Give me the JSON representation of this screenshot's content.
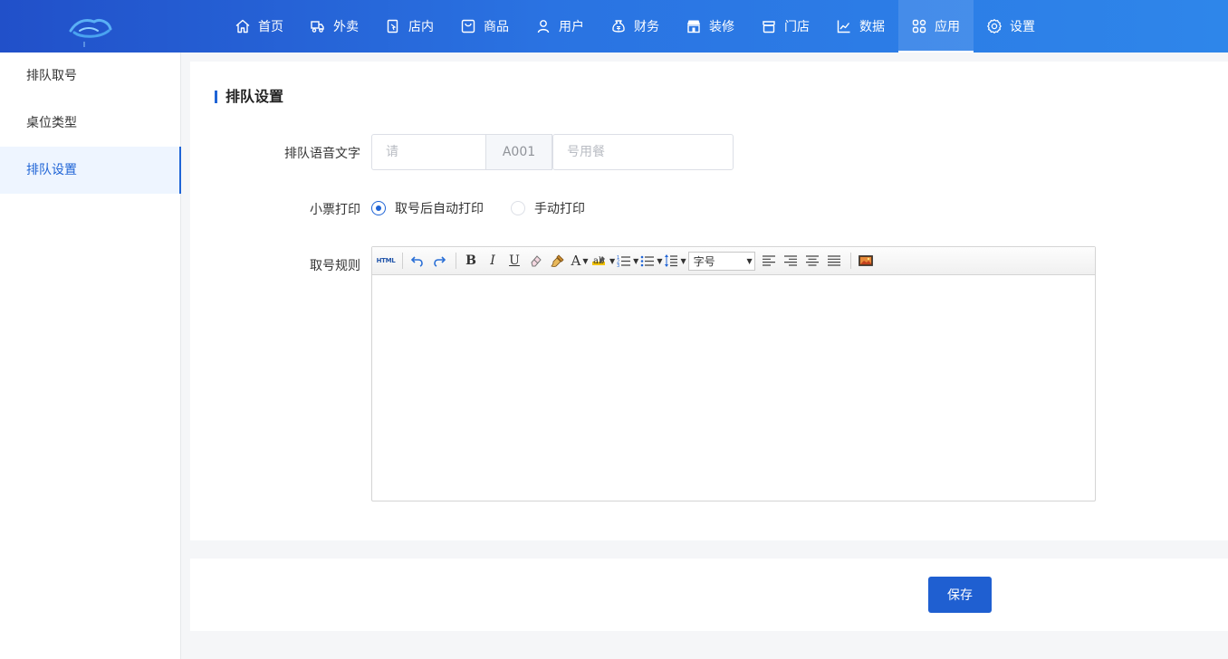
{
  "nav": {
    "items": [
      {
        "label": "首页",
        "icon": "home-icon"
      },
      {
        "label": "外卖",
        "icon": "delivery-icon"
      },
      {
        "label": "店内",
        "icon": "dine-in-icon"
      },
      {
        "label": "商品",
        "icon": "goods-icon"
      },
      {
        "label": "用户",
        "icon": "user-icon"
      },
      {
        "label": "财务",
        "icon": "finance-icon"
      },
      {
        "label": "装修",
        "icon": "decoration-icon"
      },
      {
        "label": "门店",
        "icon": "store-icon"
      },
      {
        "label": "数据",
        "icon": "chart-icon"
      },
      {
        "label": "应用",
        "icon": "apps-icon"
      },
      {
        "label": "设置",
        "icon": "settings-icon"
      }
    ],
    "active": "应用"
  },
  "sidebar": {
    "items": [
      {
        "label": "排队取号"
      },
      {
        "label": "桌位类型"
      },
      {
        "label": "排队设置"
      }
    ],
    "active": "排队设置"
  },
  "form": {
    "title": "排队设置",
    "voice": {
      "label": "排队语音文字",
      "prefix_placeholder": "请",
      "middle": "A001",
      "suffix_placeholder": "号用餐"
    },
    "ticket": {
      "label": "小票打印",
      "options": [
        "取号后自动打印",
        "手动打印"
      ],
      "selected": "取号后自动打印"
    },
    "rules": {
      "label": "取号规则",
      "toolbar": {
        "html_label": "HTML",
        "font_size_label": "字号"
      }
    }
  },
  "footer": {
    "save_label": "保存"
  },
  "colors": {
    "primary": "#1f64d6",
    "topbar_start": "#2150c9",
    "topbar_end": "#2e86ea"
  }
}
